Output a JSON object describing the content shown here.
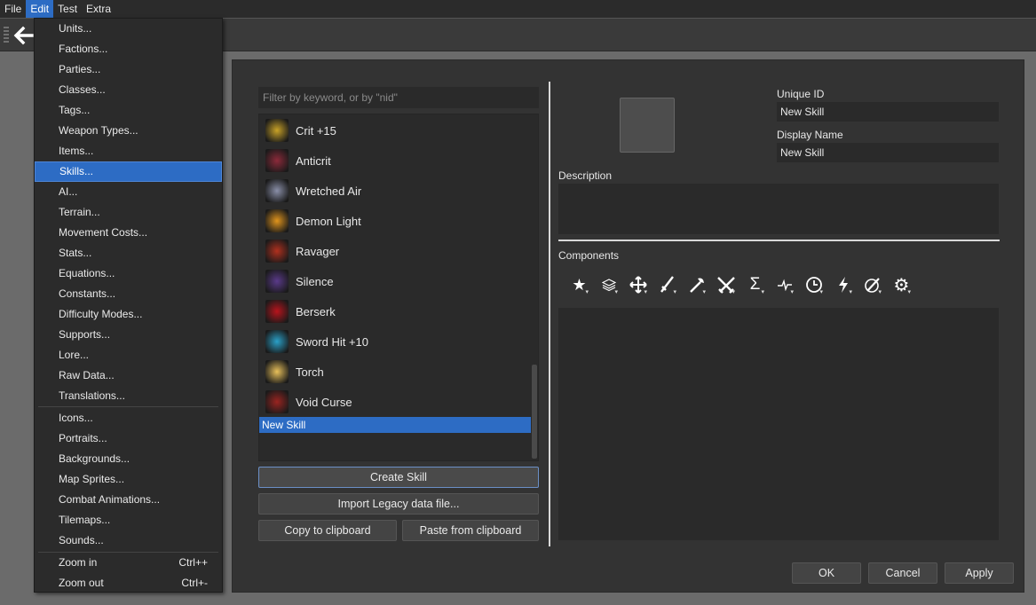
{
  "menubar": {
    "items": [
      "File",
      "Edit",
      "Test",
      "Extra"
    ]
  },
  "edit_menu": {
    "group1": [
      "Units...",
      "Factions...",
      "Parties...",
      "Classes...",
      "Tags...",
      "Weapon Types...",
      "Items...",
      "Skills...",
      "AI...",
      "Terrain...",
      "Movement Costs...",
      "Stats...",
      "Equations...",
      "Constants...",
      "Difficulty Modes...",
      "Supports...",
      "Lore...",
      "Raw Data...",
      "Translations..."
    ],
    "group2": [
      "Icons...",
      "Portraits...",
      "Backgrounds...",
      "Map Sprites...",
      "Combat Animations...",
      "Tilemaps...",
      "Sounds..."
    ],
    "zoom_in": {
      "label": "Zoom in",
      "shortcut": "Ctrl++"
    },
    "zoom_out": {
      "label": "Zoom out",
      "shortcut": "Ctrl+-"
    }
  },
  "skills_panel": {
    "filter_placeholder": "Filter by keyword, or by \"nid\"",
    "skills": [
      {
        "name": "Crit +15",
        "icon": "crit-icon",
        "color": "#c9a227"
      },
      {
        "name": "Anticrit",
        "icon": "anticrit-icon",
        "color": "#8c2a3a"
      },
      {
        "name": "Wretched Air",
        "icon": "wretched-air-icon",
        "color": "#8a8fa8"
      },
      {
        "name": "Demon Light",
        "icon": "demon-light-icon",
        "color": "#e0941c"
      },
      {
        "name": "Ravager",
        "icon": "ravager-icon",
        "color": "#b0301e"
      },
      {
        "name": "Silence",
        "icon": "silence-icon",
        "color": "#5a3a8a"
      },
      {
        "name": "Berserk",
        "icon": "berserk-icon",
        "color": "#b8141c"
      },
      {
        "name": "Sword Hit +10",
        "icon": "sword-hit-icon",
        "color": "#2aa0c8"
      },
      {
        "name": "Torch",
        "icon": "torch-icon",
        "color": "#e8c05a"
      },
      {
        "name": "Void Curse",
        "icon": "void-curse-icon",
        "color": "#9a2420"
      }
    ],
    "selected_skill": "New Skill",
    "create_button": "Create Skill",
    "import_button": "Import Legacy data file...",
    "copy_button": "Copy to clipboard",
    "paste_button": "Paste from clipboard"
  },
  "properties": {
    "unique_id_label": "Unique ID",
    "unique_id_value": "New Skill",
    "display_name_label": "Display Name",
    "display_name_value": "New Skill",
    "description_label": "Description",
    "description_value": "",
    "components_label": "Components",
    "component_icons": [
      "star-icon",
      "layers-icon",
      "move-arrows-icon",
      "sword-icon",
      "axe-icon",
      "crossed-swords-icon",
      "sigma-icon",
      "pulse-icon",
      "clock-icon",
      "lightning-icon",
      "paint-icon",
      "gear-icon"
    ]
  },
  "dialog_buttons": {
    "ok": "OK",
    "cancel": "Cancel",
    "apply": "Apply"
  },
  "colors": {
    "accent": "#2d6cc4",
    "panel": "#333333",
    "field": "#2a2a2a"
  }
}
